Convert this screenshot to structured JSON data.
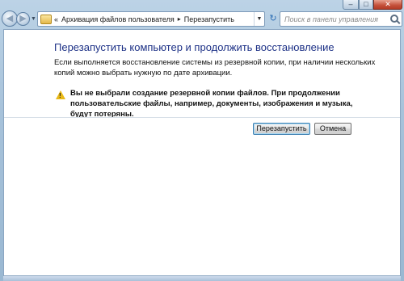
{
  "window": {
    "min_label": "–",
    "max_label": "□",
    "close_label": "✕"
  },
  "nav": {
    "back_glyph": "◀",
    "forward_glyph": "▶",
    "breadcrumb_prefix": "«",
    "crumb_1": "Архивация файлов пользователя",
    "crumb_sep": "▸",
    "crumb_2": "Перезапустить",
    "search_placeholder": "Поиск в панели управления"
  },
  "page": {
    "title": "Перезапустить компьютер и продолжить восстановление",
    "description": "Если выполняется восстановление системы из резервной копии, при наличии нескольких копий можно выбрать нужную по дате архивации.",
    "warning": "Вы не выбрали создание резервной копии файлов. При продолжении пользовательские файлы, например, документы, изображения и музыка, будут потеряны.",
    "restart_button": "Перезапустить",
    "cancel_button": "Отмена"
  }
}
